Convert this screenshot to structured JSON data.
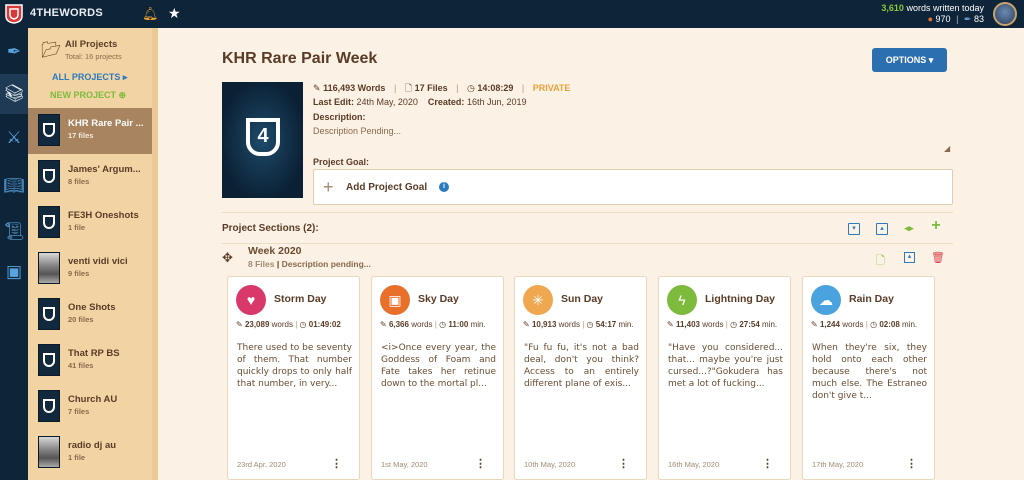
{
  "topbar": {
    "brand": "4THEWORDS",
    "words_today_count": "3,610",
    "words_today_label": "words written today",
    "coins": "970",
    "feathers": "83"
  },
  "project_list": {
    "title": "All Projects",
    "total": "Total: 16 projects",
    "all_projects_link": "ALL PROJECTS",
    "new_project_link": "NEW PROJECT",
    "items": [
      {
        "name": "KHR Rare Pair ...",
        "files": "17 files"
      },
      {
        "name": "James' Argum...",
        "files": "8 files"
      },
      {
        "name": "FE3H Oneshots",
        "files": "1 file"
      },
      {
        "name": "venti vidi vici",
        "files": "9 files"
      },
      {
        "name": "One Shots",
        "files": "20 files"
      },
      {
        "name": "That RP BS",
        "files": "41 files"
      },
      {
        "name": "Church AU",
        "files": "7 files"
      },
      {
        "name": "radio dj au",
        "files": "1 file"
      }
    ]
  },
  "project": {
    "title": "KHR Rare Pair Week",
    "options_label": "OPTIONS",
    "cover_glyph": "4",
    "words": "116,493 Words",
    "files": "17 Files",
    "time": "14:08:29",
    "privacy": "PRIVATE",
    "last_edit_label": "Last Edit:",
    "last_edit": "24th May, 2020",
    "created_label": "Created:",
    "created": "16th Jun, 2019",
    "description_label": "Description:",
    "description": "Description Pending...",
    "goal_label": "Project Goal:",
    "add_goal": "Add Project Goal"
  },
  "sections": {
    "label": "Project Sections (2):",
    "week": {
      "title": "Week 2020",
      "files": "8 Files",
      "description": "Description pending..."
    }
  },
  "cards": [
    {
      "title": "Storm Day",
      "words": "23,089",
      "time": "01:49:02",
      "time_unit": "",
      "excerpt": "There used to be seventy of them. That number quickly drops to only half that number, in very...",
      "date": "23rd Apr, 2020",
      "color": "#d9386a",
      "icon": "heart-icon"
    },
    {
      "title": "Sky Day",
      "words": "6,366",
      "time": "11:00",
      "time_unit": "min.",
      "excerpt": "<i>Once every year, the Goddess of Foam and Fate takes her retinue down to the mortal pl...",
      "date": "1st May, 2020",
      "color": "#e8702a",
      "icon": "image-icon"
    },
    {
      "title": "Sun Day",
      "words": "10,913",
      "time": "54:17",
      "time_unit": "min.",
      "excerpt": "\"Fu fu fu, it's not a bad deal, don't you think? Access to an entirely different plane of exis...",
      "date": "10th May, 2020",
      "color": "#f0a850",
      "icon": "sun-icon"
    },
    {
      "title": "Lightning Day",
      "words": "11,403",
      "time": "27:54",
      "time_unit": "min.",
      "excerpt": "\"Have you considered... that... maybe you're just cursed...?\"Gokudera has met a lot of fucking...",
      "date": "16th May, 2020",
      "color": "#7dbb3c",
      "icon": "lightning-icon"
    },
    {
      "title": "Rain Day",
      "words": "1,244",
      "time": "02:08",
      "time_unit": "min.",
      "excerpt": "When they're six, they hold onto each other because there's not much else. The Estraneo don't give t...",
      "date": "17th May, 2020",
      "color": "#4aa3df",
      "icon": "rain-cloud-icon"
    }
  ],
  "words_unit": "words"
}
